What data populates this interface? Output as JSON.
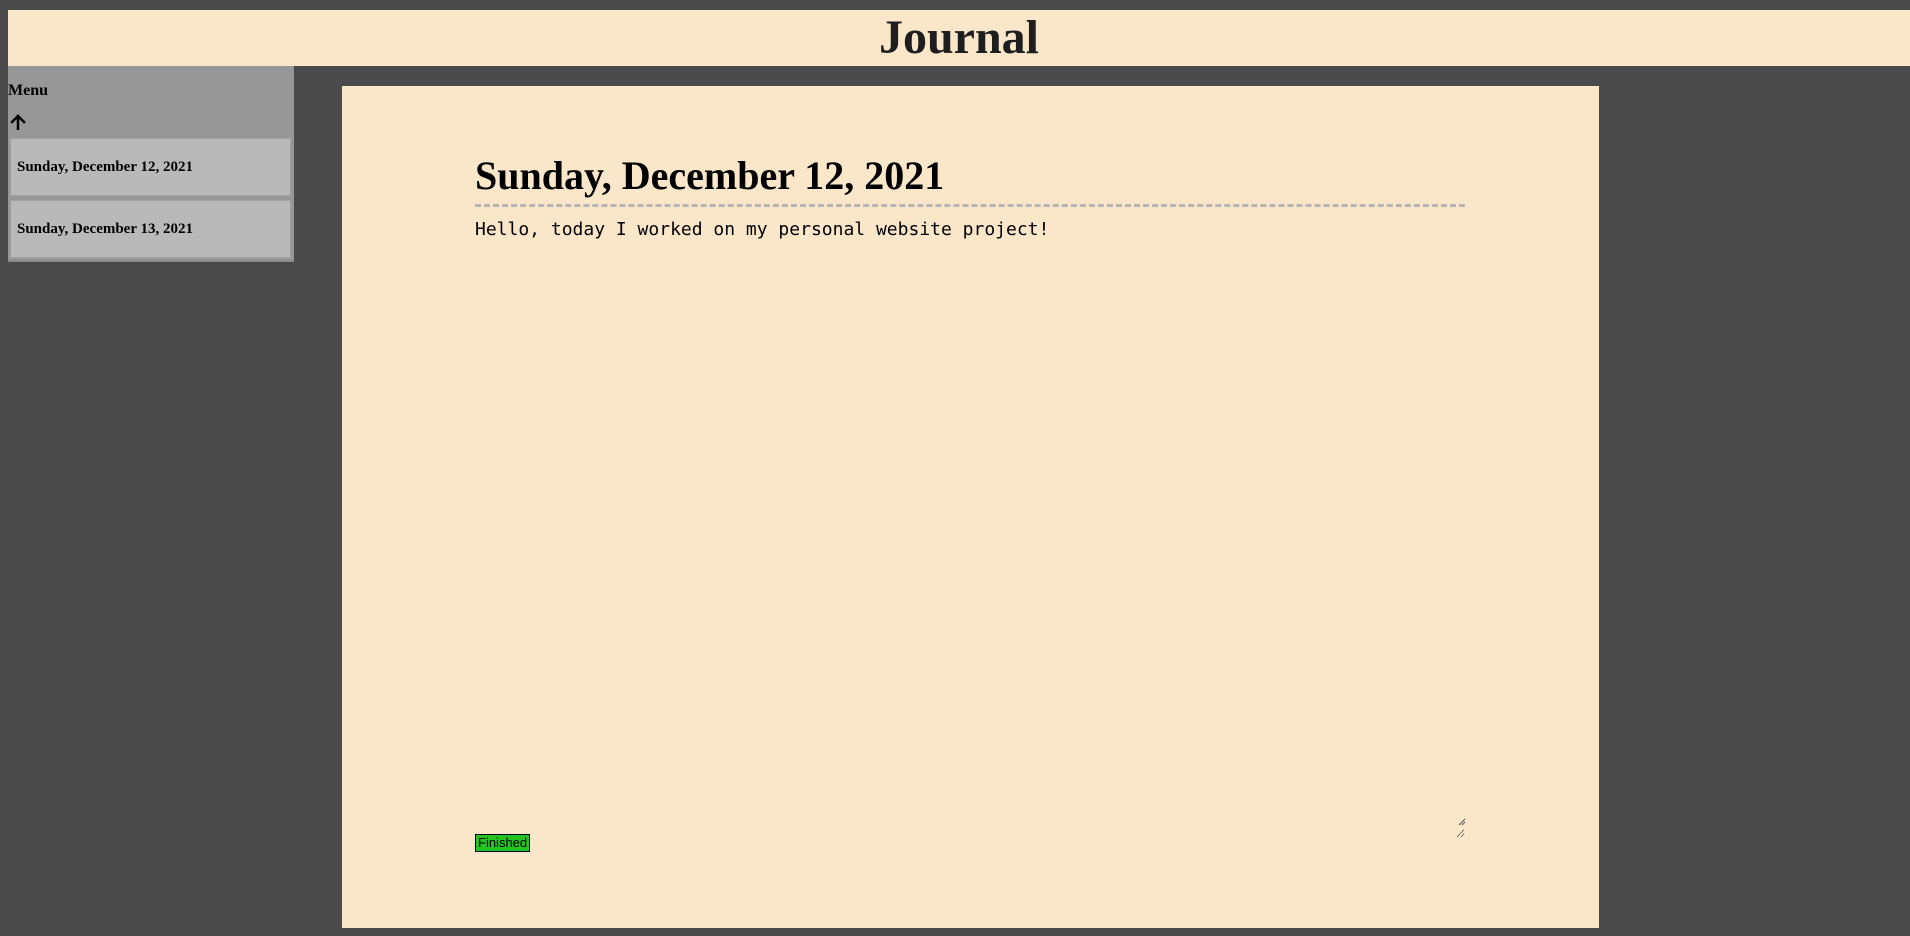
{
  "header": {
    "title": "Journal"
  },
  "sidebar": {
    "menu_label": "Menu",
    "collapse_icon": "arrow-up-icon",
    "items": [
      {
        "label": "Sunday, December 12, 2021"
      },
      {
        "label": "Sunday, December 13, 2021"
      }
    ]
  },
  "main": {
    "entry_title": "Sunday, December 12, 2021",
    "entry_text": "Hello, today I worked on my personal website project!",
    "finished_label": "Finished"
  },
  "colors": {
    "page_background": "#4a4a4a",
    "paper": "#fae6c8",
    "sidebar": "#979797",
    "sidebar_item": "#b9b9b9",
    "finished_button": "#22c322"
  }
}
